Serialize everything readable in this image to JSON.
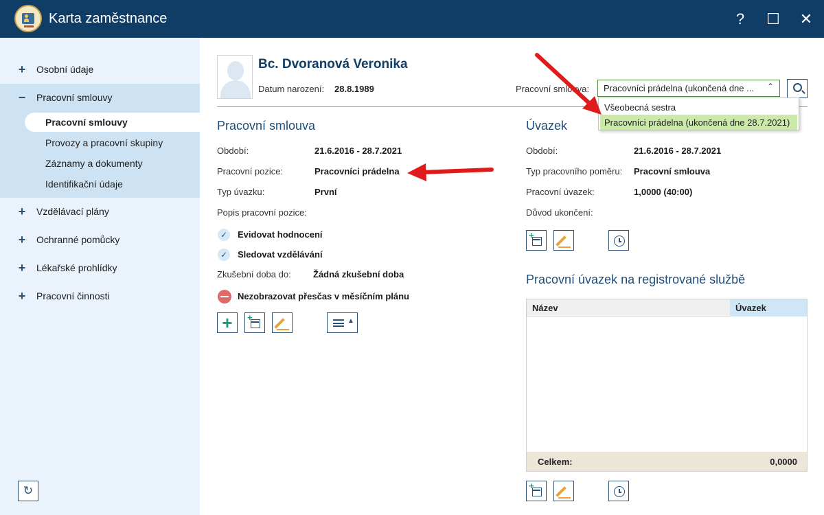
{
  "window": {
    "title": "Karta zaměstnance",
    "help": "?",
    "maximize": "☐",
    "close": "✕"
  },
  "sidebar": {
    "items": [
      {
        "sign": "+",
        "label": "Osobní údaje"
      },
      {
        "sign": "−",
        "label": "Pracovní smlouvy"
      },
      {
        "sign": "+",
        "label": "Vzdělávací plány"
      },
      {
        "sign": "+",
        "label": "Ochranné pomůcky"
      },
      {
        "sign": "+",
        "label": "Lékařské prohlídky"
      },
      {
        "sign": "+",
        "label": "Pracovní činnosti"
      }
    ],
    "subitems": [
      {
        "label": "Pracovní smlouvy",
        "active": true
      },
      {
        "label": "Provozy a pracovní skupiny"
      },
      {
        "label": "Záznamy a dokumenty"
      },
      {
        "label": "Identifikační údaje"
      }
    ],
    "refresh_icon": "↻"
  },
  "header": {
    "name": "Bc. Dvoranová Veronika",
    "dob_label": "Datum narození:",
    "dob_value": "28.8.1989",
    "contract_label": "Pracovní smlouva:",
    "contract_value": "Pracovníci prádelna (ukončená dne ...",
    "contract_chevron": "⌃",
    "dropdown_options": [
      "Všeobecná sestra",
      "Pracovníci prádelna (ukončená dne 28.7.2021)"
    ]
  },
  "contract": {
    "title": "Pracovní smlouva",
    "period_label": "Období:",
    "period_value": "21.6.2016 - 28.7.2021",
    "position_label": "Pracovní pozice:",
    "position_value": "Pracovníci prádelna",
    "type_label": "Typ úvazku:",
    "type_value": "První",
    "desc_label": "Popis pracovní pozice:",
    "check1": "Evidovat hodnocení",
    "check2": "Sledovat vzdělávání",
    "trial_label": "Zkušební doba do:",
    "trial_value": "Žádná zkušební doba",
    "overtime": "Nezobrazovat přesčas v měsíčním plánu",
    "check_glyph": "✓",
    "menu_caret": "▲"
  },
  "workload": {
    "title": "Úvazek",
    "period_label": "Období:",
    "period_value": "21.6.2016 - 28.7.2021",
    "relation_label": "Typ pracovního poměru:",
    "relation_value": "Pracovní smlouva",
    "load_label": "Pracovní úvazek:",
    "load_value": "1,0000 (40:00)",
    "reason_label": "Důvod ukončení:"
  },
  "service": {
    "title": "Pracovní úvazek na registrované službě",
    "col_name": "Název",
    "col_load": "Úvazek",
    "total_label": "Celkem:",
    "total_value": "0,0000"
  },
  "colors": {
    "titlebar": "#0f3d66",
    "sidebar": "#eaf3fb",
    "sidebar_group": "#cde2f2",
    "accent": "#1f4f7a",
    "selected_option": "#cbe9a9",
    "arrow": "#e01b1b"
  }
}
